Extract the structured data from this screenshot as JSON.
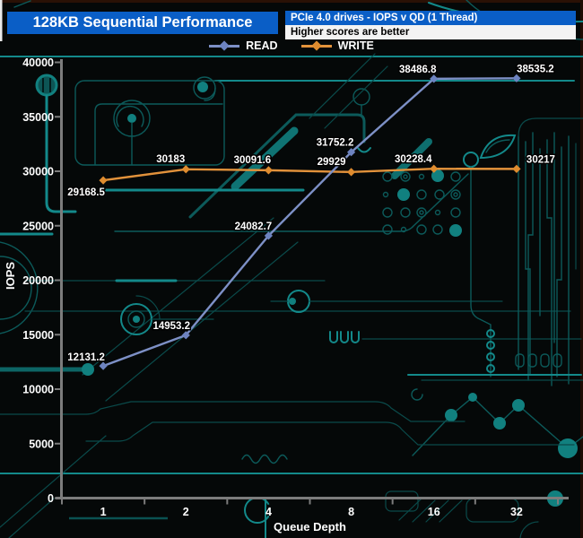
{
  "header": {
    "title": "128KB Sequential Performance",
    "subtitle": "PCIe 4.0 drives - IOPS v QD (1 Thread)",
    "note": "Higher scores are better",
    "title_bg": "#0a5ec6",
    "note_bg": "#f3f3f3"
  },
  "chart_data": {
    "type": "line",
    "title": "128KB Sequential Performance",
    "subtitle": "PCIe 4.0 drives - IOPS v QD (1 Thread)",
    "note": "Higher scores are better",
    "xlabel": "Queue Depth",
    "ylabel": "IOPS",
    "categories": [
      "1",
      "2",
      "4",
      "8",
      "16",
      "32"
    ],
    "ylim": [
      0,
      40000
    ],
    "ytick_interval": 5000,
    "grid": false,
    "legend_position": "top",
    "series": [
      {
        "name": "READ",
        "color": "#7d90c6",
        "marker_color": "#6d83c0",
        "values": [
          12131.2,
          14953.2,
          24082.7,
          31752.2,
          38486.8,
          38535.2
        ],
        "labels": [
          "12131.2",
          "14953.2",
          "24082.7",
          "31752.2",
          "38486.8",
          "38535.2"
        ]
      },
      {
        "name": "WRITE",
        "color": "#e2923b",
        "marker_color": "#df8c2f",
        "values": [
          29168.5,
          30183,
          30091.6,
          29929,
          30228.4,
          30217
        ],
        "labels": [
          "29168.5",
          "30183",
          "30091.6",
          "29929",
          "30228.4",
          "30217"
        ]
      }
    ]
  },
  "theme": {
    "axis_color": "#7c7c7c",
    "label_color": "#ffffff",
    "circuit_color": "#0c5a5a",
    "circuit_bright": "#13898a",
    "background": "#050808"
  }
}
